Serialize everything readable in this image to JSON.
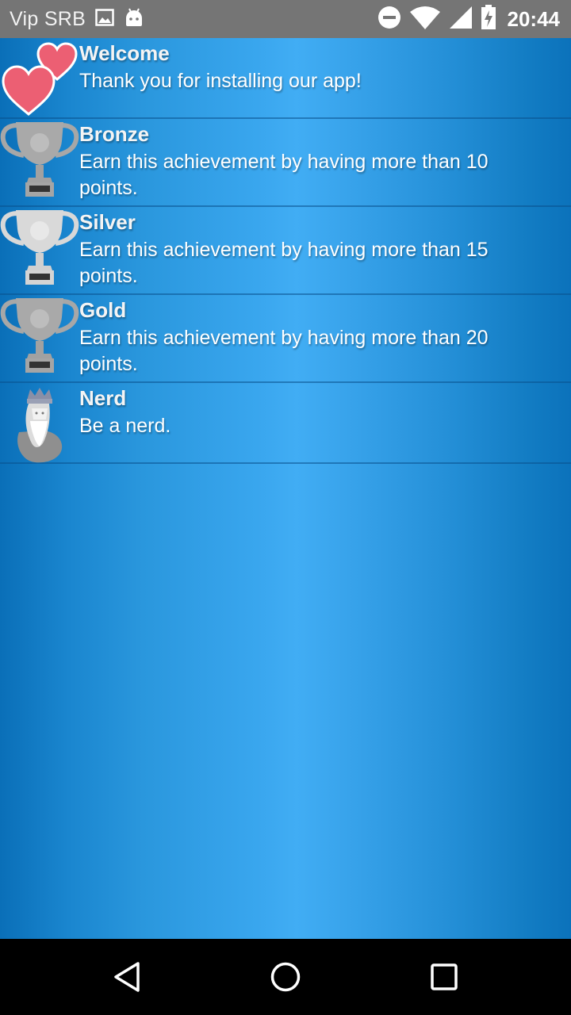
{
  "status_bar": {
    "carrier": "Vip SRB",
    "time": "20:44",
    "icons": [
      "image-icon",
      "android-icon",
      "do-not-disturb-icon",
      "wifi-icon",
      "signal-icon",
      "battery-charging-icon"
    ]
  },
  "achievements": [
    {
      "title": "Welcome",
      "description": "Thank you for installing our app!",
      "icon": "hearts-icon"
    },
    {
      "title": "Bronze",
      "description": "Earn this achievement by having more than 10 points.",
      "icon": "trophy-icon"
    },
    {
      "title": "Silver",
      "description": "Earn this achievement by having more than 15 points.",
      "icon": "trophy-icon"
    },
    {
      "title": "Gold",
      "description": "Earn this achievement by having more than 20 points.",
      "icon": "trophy-icon"
    },
    {
      "title": "Nerd",
      "description": "Be a nerd.",
      "icon": "wizard-icon"
    }
  ],
  "navigation": {
    "buttons": [
      "back-icon",
      "home-icon",
      "recents-icon"
    ]
  },
  "colors": {
    "status_bar": "#757575",
    "background_light": "#41adf4",
    "background_dark": "#0a6fb8",
    "heart": "#ec5f73",
    "trophy": "#a8a8a8"
  }
}
